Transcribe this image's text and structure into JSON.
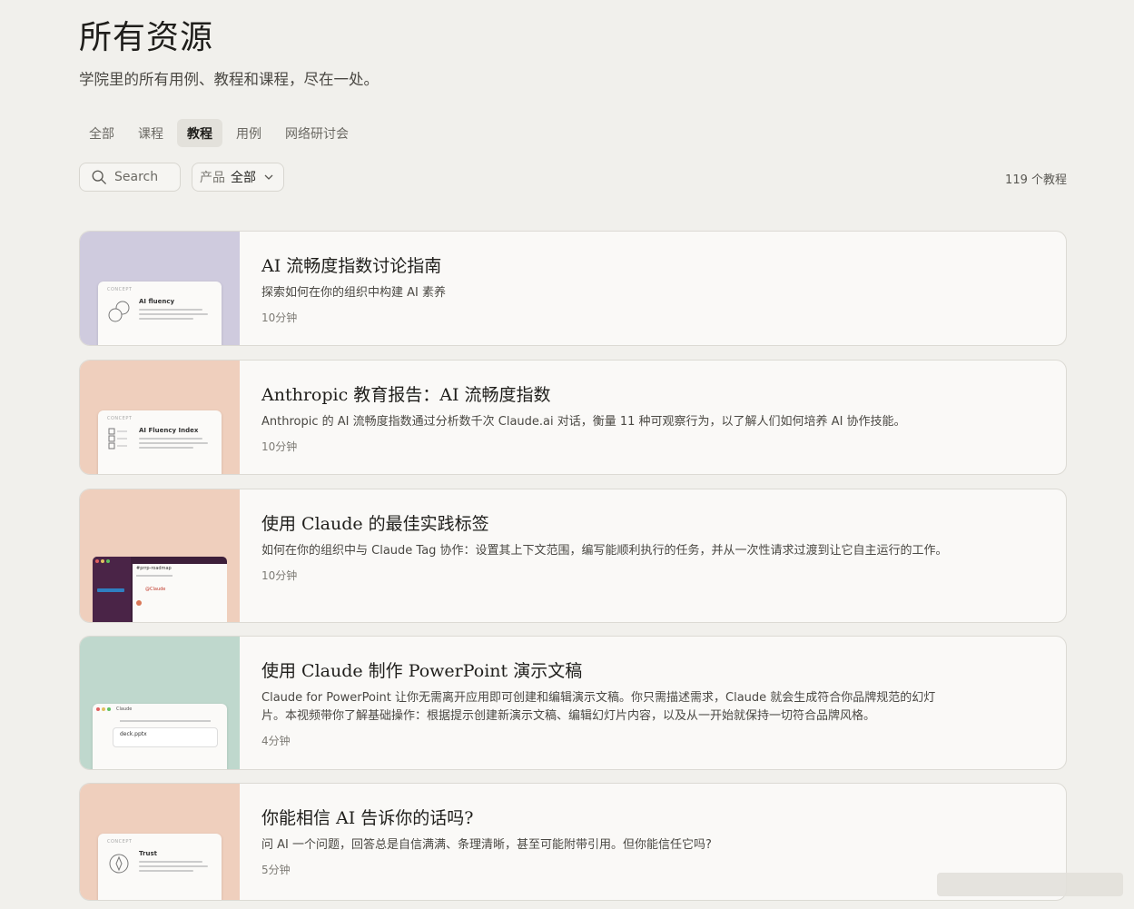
{
  "header": {
    "title": "所有资源",
    "subtitle": "学院里的所有用例、教程和课程，尽在一处。"
  },
  "tabs": [
    {
      "label": "全部",
      "active": false
    },
    {
      "label": "课程",
      "active": false
    },
    {
      "label": "教程",
      "active": true
    },
    {
      "label": "用例",
      "active": false
    },
    {
      "label": "网络研讨会",
      "active": false
    }
  ],
  "search": {
    "placeholder": "Search"
  },
  "filter": {
    "label": "产品",
    "value": "全部"
  },
  "result_count": "119 个教程",
  "cards": [
    {
      "title": "AI 流畅度指数讨论指南",
      "description": "探索如何在你的组织中构建 AI 素养",
      "duration": "10分钟",
      "thumb_color": "#cfcbde",
      "thumb_kicker": "CONCEPT",
      "thumb_title": "AI fluency"
    },
    {
      "title": "Anthropic 教育报告：AI 流畅度指数",
      "description": "Anthropic 的 AI 流畅度指数通过分析数千次 Claude.ai 对话，衡量 11 种可观察行为，以了解人们如何培养 AI 协作技能。",
      "duration": "10分钟",
      "thumb_color": "#efcfbd",
      "thumb_kicker": "CONCEPT",
      "thumb_title": "AI Fluency Index"
    },
    {
      "title": "使用 Claude 的最佳实践标签",
      "description": "如何在你的组织中与 Claude Tag 协作：设置其上下文范围，编写能顺利执行的任务，并从一次性请求过渡到让它自主运行的工作。",
      "duration": "10分钟",
      "thumb_color": "#efcfbd",
      "thumb_kicker": "#prrp-roadmap",
      "thumb_title": "@Claude"
    },
    {
      "title": "使用 Claude 制作 PowerPoint 演示文稿",
      "description": "Claude for PowerPoint 让你无需离开应用即可创建和编辑演示文稿。你只需描述需求，Claude 就会生成符合你品牌规范的幻灯片。本视频带你了解基础操作：根据提示创建新演示文稿、编辑幻灯片内容，以及从一开始就保持一切符合品牌风格。",
      "duration": "4分钟",
      "thumb_color": "#bfd8cd",
      "thumb_kicker": "Claude",
      "thumb_title": "deck.pptx"
    },
    {
      "title": "你能相信 AI 告诉你的话吗?",
      "description": "问 AI 一个问题，回答总是自信满满、条理清晰，甚至可能附带引用。但你能信任它吗?",
      "duration": "5分钟",
      "thumb_color": "#efcfbd",
      "thumb_kicker": "CONCEPT",
      "thumb_title": "Trust"
    }
  ]
}
